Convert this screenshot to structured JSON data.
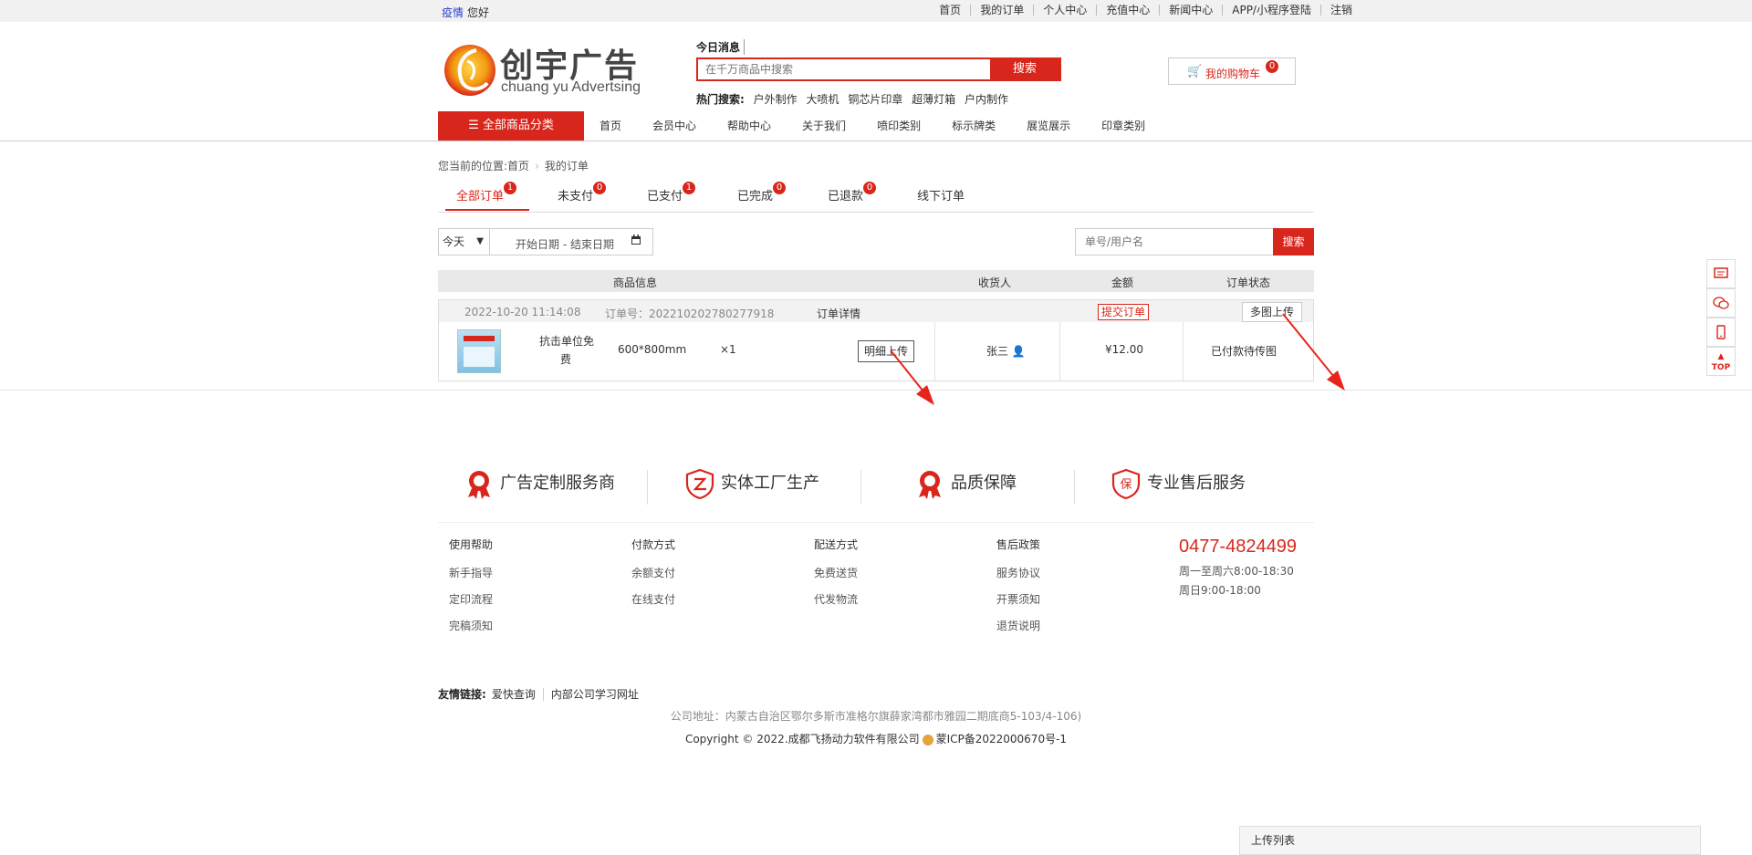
{
  "topbar": {
    "greet_link": "疫情",
    "greet_text": "您好",
    "links": [
      "首页",
      "我的订单",
      "个人中心",
      "充值中心",
      "新闻中心",
      "APP/小程序登陆",
      "注销"
    ]
  },
  "header": {
    "logo_cn": "创宇广告",
    "logo_en": "chuang yu Advertsing",
    "message_label": "今日消息",
    "search_placeholder": "在千万商品中搜索",
    "search_button": "搜索",
    "hot_label": "热门搜索:",
    "hot_items": [
      "户外制作",
      "大喷机",
      "铜芯片印章",
      "超薄灯箱",
      "户内制作"
    ],
    "cart_label": "我的购物车",
    "cart_count": "0"
  },
  "nav": {
    "all_categories": "全部商品分类",
    "items": [
      "首页",
      "会员中心",
      "帮助中心",
      "关于我们",
      "喷印类别",
      "标示牌类",
      "展览展示",
      "印章类别"
    ]
  },
  "breadcrumb": {
    "prefix": "您当前的位置:",
    "home": "首页",
    "current": "我的订单"
  },
  "tabs": [
    {
      "label": "全部订单",
      "count": "1"
    },
    {
      "label": "未支付",
      "count": "0"
    },
    {
      "label": "已支付",
      "count": "1"
    },
    {
      "label": "已完成",
      "count": "0"
    },
    {
      "label": "已退款",
      "count": "0"
    },
    {
      "label": "线下订单",
      "count": ""
    }
  ],
  "filters": {
    "range_select": "今天",
    "date_range": "开始日期 - 结束日期",
    "query_placeholder": "单号/用户名",
    "query_button": "搜索"
  },
  "table": {
    "headers": [
      "商品信息",
      "收货人",
      "金额",
      "订单状态"
    ]
  },
  "order": {
    "datetime": "2022-10-20 11:14:08",
    "order_no": "订单号：202210202780277918",
    "detail_link": "订单详情",
    "submit_button": "提交订单",
    "multi_upload_button": "多图上传",
    "product_name_line1": "抗击单位免",
    "product_name_line2": "费",
    "size": "600*800mm",
    "qty": "×1",
    "upload_button": "明细上传",
    "receiver": "张三",
    "amount": "¥12.00",
    "status": "已付款待传图"
  },
  "features": [
    "广告定制服务商",
    "实体工厂生产",
    "品质保障",
    "专业售后服务"
  ],
  "footer": {
    "cols": [
      {
        "title": "使用帮助",
        "items": [
          "新手指导",
          "定印流程",
          "完稿须知"
        ]
      },
      {
        "title": "付款方式",
        "items": [
          "余额支付",
          "在线支付"
        ]
      },
      {
        "title": "配送方式",
        "items": [
          "免费送货",
          "代发物流"
        ]
      },
      {
        "title": "售后政策",
        "items": [
          "服务协议",
          "开票须知",
          "退货说明"
        ]
      }
    ],
    "phone": "0477-4824499",
    "hours": "周一至周六8:00-18:30 周日9:00-18:00",
    "friend_label": "友情链接:",
    "friend_links": [
      "爱快查询",
      "内部公司学习网址"
    ],
    "address": "公司地址：内蒙古自治区鄂尔多斯市准格尔旗薛家湾都市雅园二期底商5-103/4-106)",
    "copyright": "Copyright © 2022.成都飞扬动力软件有限公司",
    "icp": "蒙ICP备2022000670号-1"
  },
  "side": {
    "top_label": "TOP"
  },
  "upload_list": "上传列表",
  "colors": {
    "brand_red": "#d9261c"
  }
}
